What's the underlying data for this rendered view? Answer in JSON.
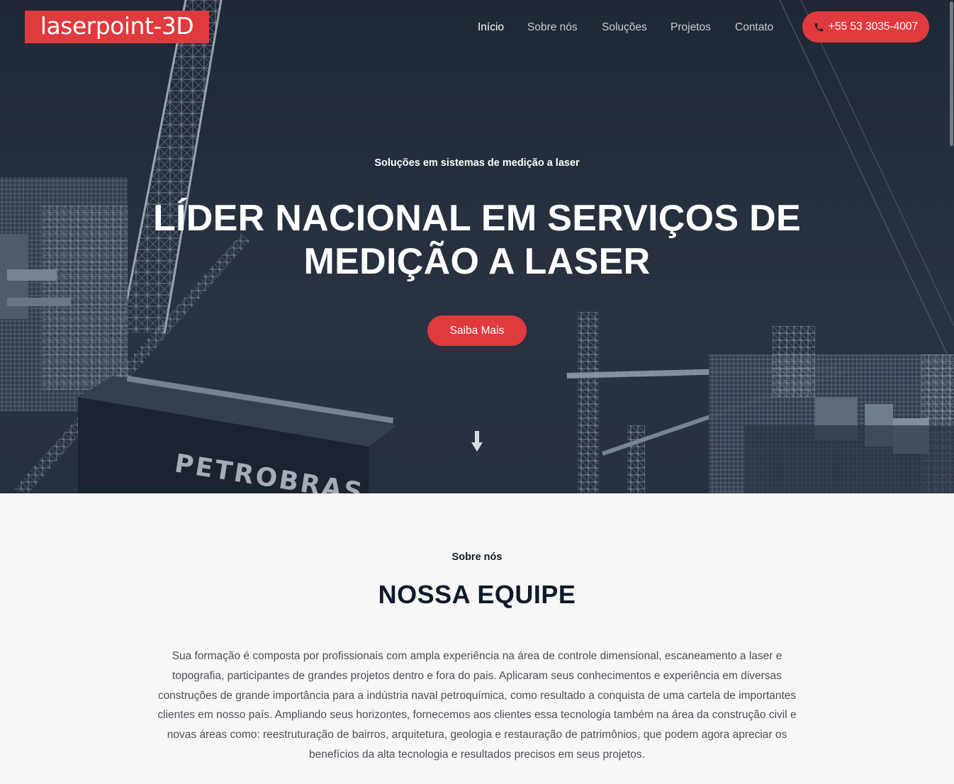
{
  "brand": {
    "logo_text": "laserpoint-3D",
    "accent_color": "#e0393e"
  },
  "nav": {
    "items": [
      {
        "label": "Início",
        "active": true
      },
      {
        "label": "Sobre nós",
        "active": false
      },
      {
        "label": "Soluções",
        "active": false
      },
      {
        "label": "Projetos",
        "active": false
      },
      {
        "label": "Contato",
        "active": false
      }
    ],
    "phone": {
      "label": "+55 53 3035-4007",
      "icon": "phone-icon"
    }
  },
  "hero": {
    "eyebrow": "Soluções em sistemas de medição a laser",
    "title_line1": "LÍDER NACIONAL EM SERVIÇOS DE",
    "title_line2": "MEDIÇÃO A LASER",
    "cta_label": "Saiba Mais",
    "background_text": "PETROBRAS",
    "scroll_icon": "arrow-down-icon"
  },
  "about": {
    "eyebrow": "Sobre nós",
    "title": "NOSSA EQUIPE",
    "body": "Sua formação é composta por profissionais com ampla experiência na área de controle dimensional, escaneamento a laser e topografia, participantes de grandes projetos dentro e fora do pais. Aplicaram seus conhecimentos e experiência em diversas construções de grande importância para a indústria naval petroquímica, como resultado a conquista de uma cartela de importantes clientes em nosso país. Ampliando seus horizontes, fornecemos aos clientes essa tecnologia também na área da construção civil e novas áreas como: reestruturação de bairros, arquitetura, geologia e restauração de patrimônios, que podem agora apreciar os benefícios da alta tecnologia e resultados precisos em seus projetos."
  }
}
